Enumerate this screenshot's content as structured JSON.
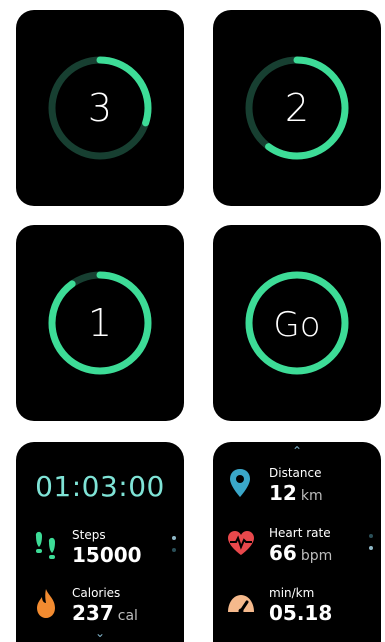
{
  "countdown": [
    {
      "number": "3",
      "progress": 0.3
    },
    {
      "number": "2",
      "progress": 0.6
    },
    {
      "number": "1",
      "progress": 0.9
    },
    {
      "number": "Go",
      "progress": 1.0
    }
  ],
  "summary": {
    "time": "01:03:00",
    "stats": [
      {
        "label": "Steps",
        "value": "15000",
        "unit": ""
      },
      {
        "label": "Calories",
        "value": "237",
        "unit": "cal"
      }
    ]
  },
  "details": {
    "stats": [
      {
        "label": "Distance",
        "value": "12",
        "unit": "km"
      },
      {
        "label": "Heart rate",
        "value": "66",
        "unit": "bpm"
      },
      {
        "label": "min/km",
        "value": "05.18",
        "unit": ""
      }
    ]
  },
  "colors": {
    "accent": "#3ddc97",
    "track": "#173f31",
    "time": "#7fe3d6"
  },
  "icons": [
    "shoe-prints-icon",
    "flame-icon",
    "location-pin-icon",
    "heart-rate-icon",
    "speedometer-icon"
  ]
}
